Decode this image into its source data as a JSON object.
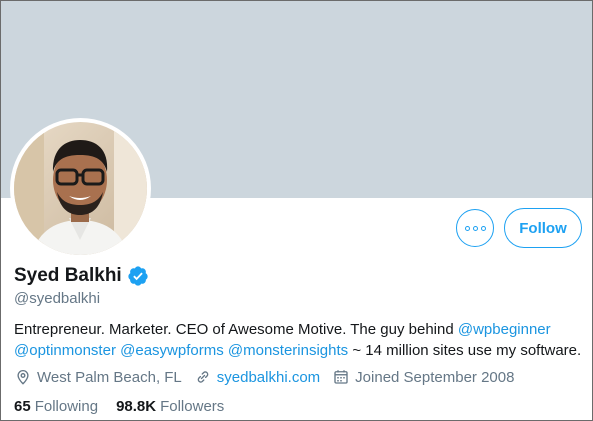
{
  "profile": {
    "name": "Syed Balkhi",
    "handle": "@syedbalkhi",
    "verified": true,
    "bio": {
      "line1_text": "Entrepreneur. Marketer. CEO of Awesome Motive. The guy behind ",
      "mention1": "@wpbeginner",
      "mention2": "@optinmonster",
      "mention3": "@easywpforms",
      "mention4": "@monsterinsights",
      "tail_text": " ~ 14 million sites use my software."
    },
    "location": "West Palm Beach, FL",
    "website": "syedbalkhi.com",
    "joined": "Joined September 2008",
    "following_count": "65",
    "following_label": "Following",
    "followers_count": "98.8K",
    "followers_label": "Followers"
  },
  "actions": {
    "follow_label": "Follow",
    "more_icon": "more-dots-icon"
  },
  "colors": {
    "banner": "#ccd6dd",
    "accent": "#1da1f2",
    "link": "#1b95e0",
    "secondary_text": "#657786",
    "primary_text": "#14171a"
  }
}
